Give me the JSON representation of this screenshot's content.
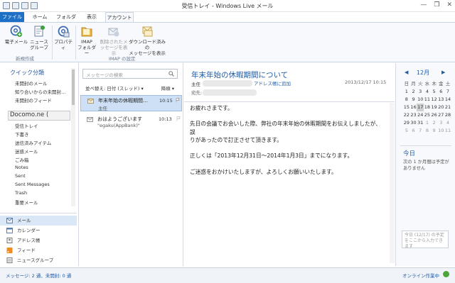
{
  "window": {
    "title": "受信トレイ - Windows Live メール",
    "controls": [
      "—",
      "❐",
      "✕"
    ]
  },
  "ribbon_tabs": [
    "ファイル",
    "ホーム",
    "フォルダー",
    "表示",
    "アカウント"
  ],
  "ribbon": {
    "new_email": "電子メール",
    "newsgroup": [
      "ニュース",
      "グループ"
    ],
    "properties": "プロパティ",
    "imap_folders": [
      "IMAP",
      "フォルダー"
    ],
    "show_deleted": [
      "削除されたメ",
      "ッセージを表示"
    ],
    "show_downloaded": [
      "ダウンロード済みの",
      "メッセージを表示"
    ],
    "group_new": "新規作成",
    "group_imap": "IMAP の設定"
  },
  "nav": {
    "quick_views_title": "クイック分類",
    "quick_views": [
      "未開封のメール",
      "知り合いからの未開封…",
      "未開封のフィード"
    ],
    "account_title": "Docomo.ne (",
    "folders": [
      "受信トレイ",
      "下書き",
      "送信済みアイテム",
      "迷惑メール",
      "ごみ箱",
      "Notes",
      "Sent",
      "Sent Messages",
      "Trash",
      "重要メール"
    ],
    "sections": [
      "メール",
      "カレンダー",
      "アドレス帳",
      "フィード",
      "ニュースグループ"
    ]
  },
  "message_list": {
    "search_placeholder": "メッセージの検索",
    "sort_label": "並べ替え: 日付 (スレッド)",
    "sort_dir": "降順",
    "messages": [
      {
        "subject": "年末年始の休暇期間…",
        "time": "10:15",
        "from": "主任"
      },
      {
        "subject": "おはようございます",
        "time": "10:13",
        "from": "\"egaku(AppBank)\""
      }
    ]
  },
  "reading": {
    "subject": "年末年始の休暇期間について",
    "from": "主任",
    "add_contact": "アドレス帳に追加",
    "date": "2013/12/17 10:15",
    "to_label": "宛先:",
    "body": [
      "お疲れさまです。",
      "",
      "先日の会議でお会いした際、弊社の年末年始の休暇期間をお伝えしましたが、誤",
      "りがあったので訂正させて頂きます。",
      "",
      "正しくは「2013年12月31日～2014年1月3日」までになります。",
      "",
      "ご迷惑をおかけいたしますが、よろしくお願いいたします。"
    ]
  },
  "calendar": {
    "month": "12月",
    "prev": "◀",
    "next": "▶",
    "weekdays": [
      "日",
      "月",
      "火",
      "水",
      "木",
      "金",
      "土"
    ],
    "weeks": [
      [
        "1",
        "2",
        "3",
        "4",
        "5",
        "6",
        "7"
      ],
      [
        "8",
        "9",
        "10",
        "11",
        "12",
        "13",
        "14"
      ],
      [
        "15",
        "16",
        "17",
        "18",
        "19",
        "20",
        "21"
      ],
      [
        "22",
        "23",
        "24",
        "25",
        "26",
        "27",
        "28"
      ],
      [
        "29",
        "30",
        "31",
        "1",
        "2",
        "3",
        "4"
      ],
      [
        "5",
        "6",
        "7",
        "8",
        "9",
        "10",
        "11"
      ]
    ],
    "today_title": "今日",
    "today_text": "次の 1 か月間は予定がありません",
    "quick_add": "今日 (12/17) の予定をここから入力できます"
  },
  "status": {
    "left": "メッセージ: 2 通、未開封: 0 通",
    "right": "オンライン作業中"
  },
  "colors": {
    "accent": "#1e6fc6",
    "link": "#1f5aa6",
    "selection": "#cde0f5"
  }
}
